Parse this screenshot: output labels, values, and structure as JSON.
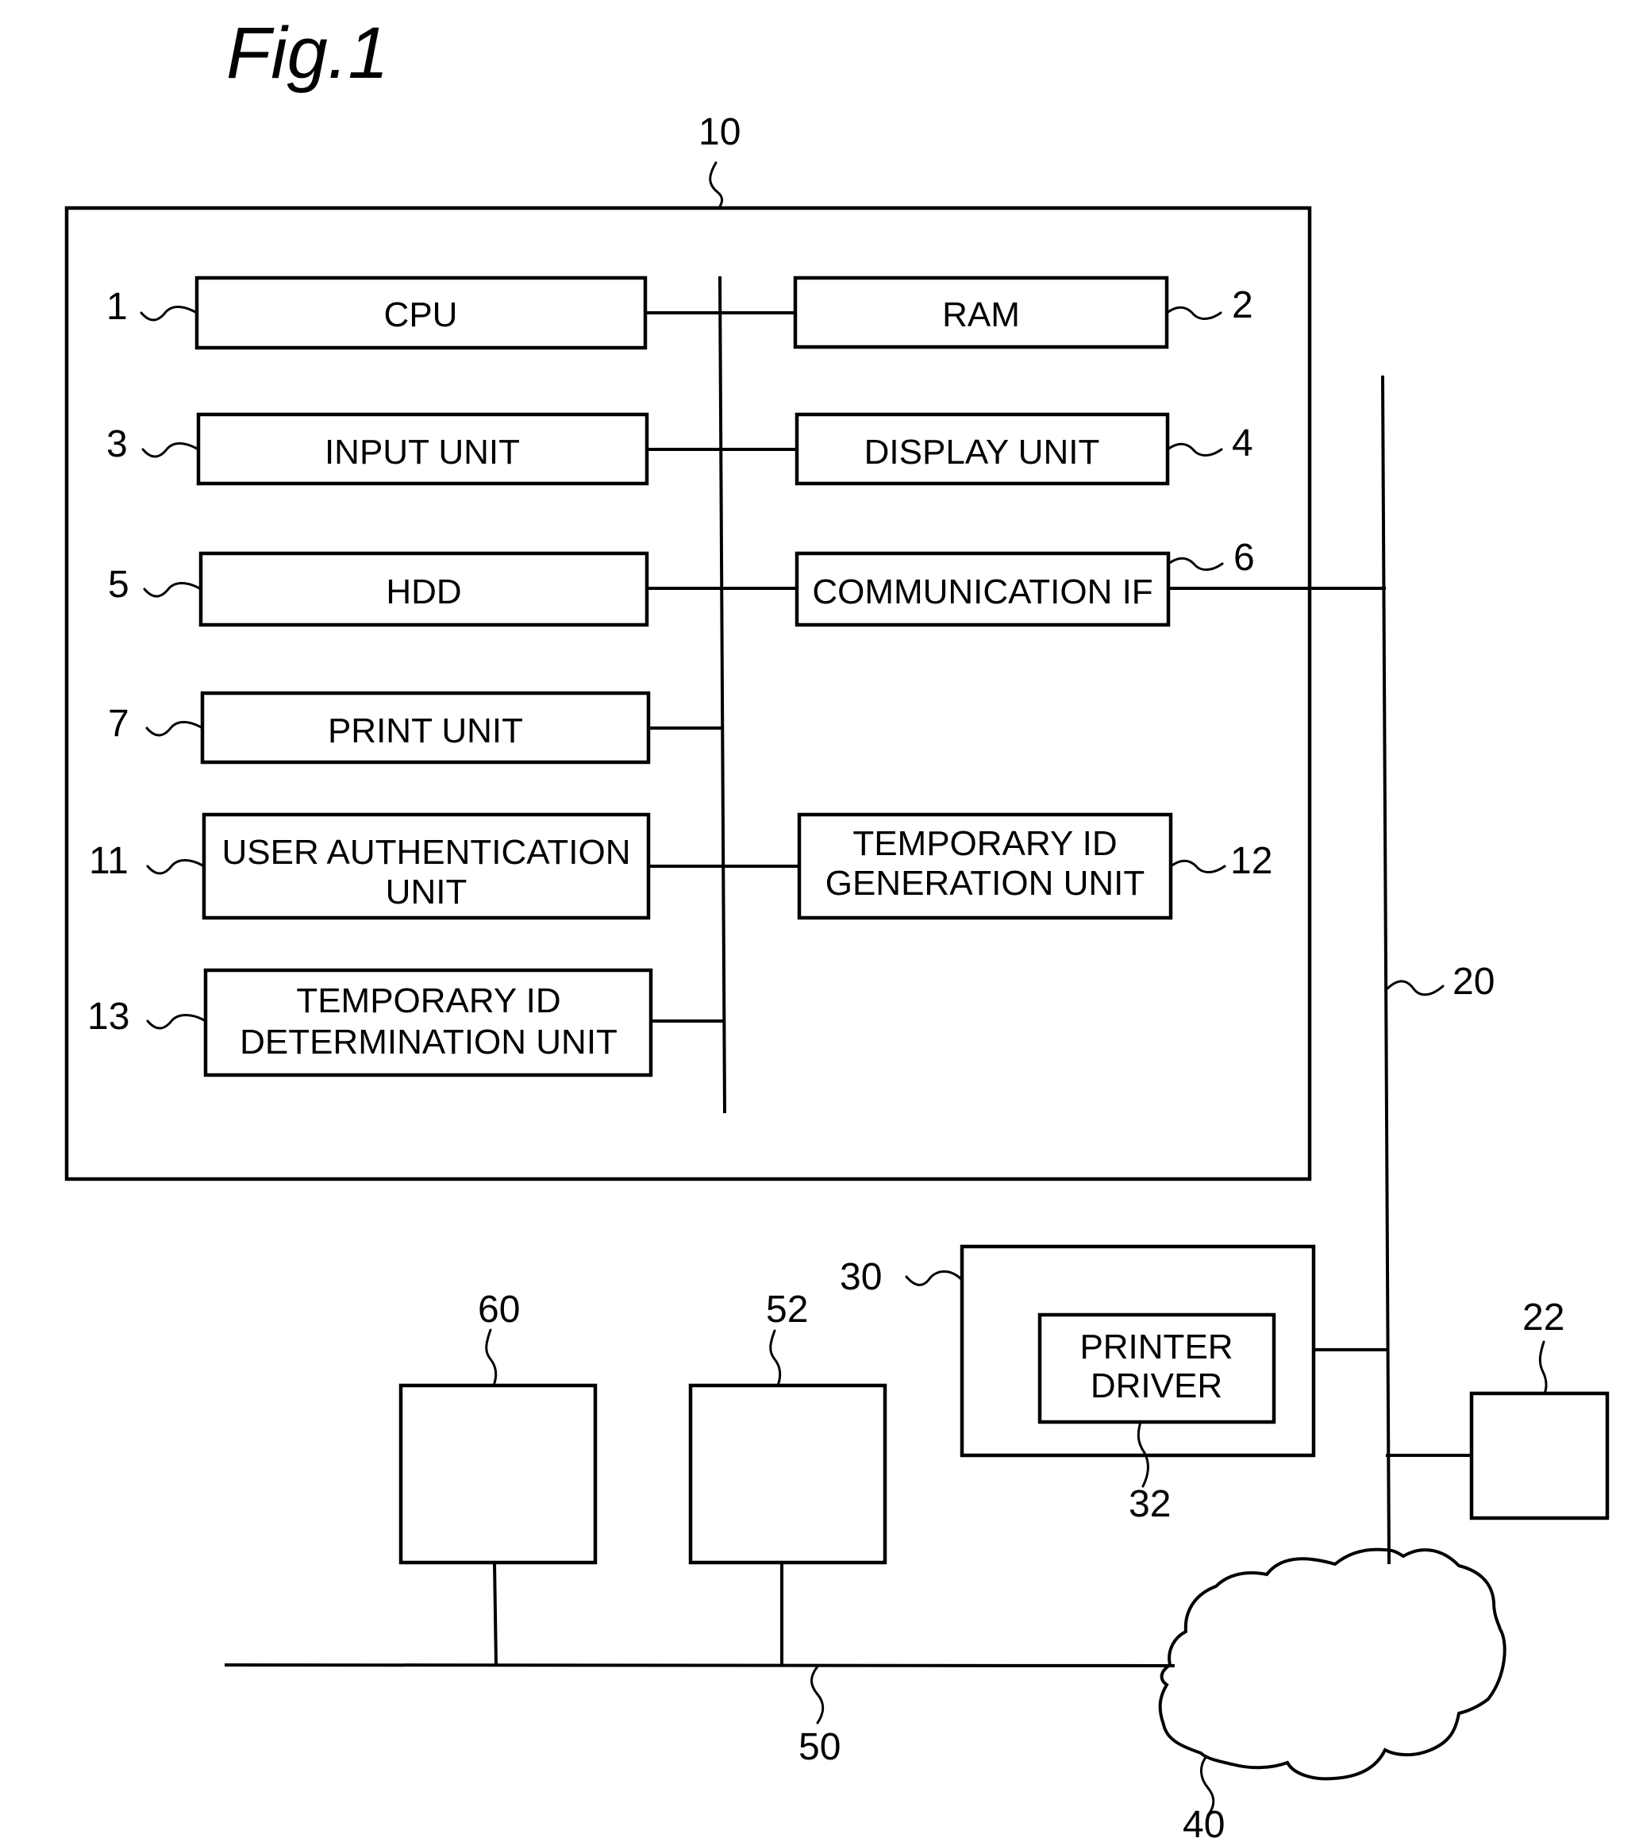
{
  "figure": {
    "title": "Fig.1"
  },
  "apparatus": {
    "ref": "10",
    "units": [
      {
        "ref": "1",
        "lines": [
          "CPU"
        ]
      },
      {
        "ref": "2",
        "lines": [
          "RAM"
        ]
      },
      {
        "ref": "3",
        "lines": [
          "INPUT  UNIT"
        ]
      },
      {
        "ref": "4",
        "lines": [
          "DISPLAY  UNIT"
        ]
      },
      {
        "ref": "5",
        "lines": [
          "HDD"
        ]
      },
      {
        "ref": "6",
        "lines": [
          "COMMUNICATION  IF"
        ]
      },
      {
        "ref": "7",
        "lines": [
          "PRINT  UNIT"
        ]
      },
      {
        "ref": "11",
        "lines": [
          "USER  AUTHENTICATION",
          "UNIT"
        ]
      },
      {
        "ref": "12",
        "lines": [
          "TEMPORARY  ID",
          "GENERATION  UNIT"
        ]
      },
      {
        "ref": "13",
        "lines": [
          "TEMPORARY  ID",
          "DETERMINATION  UNIT"
        ]
      }
    ]
  },
  "network": {
    "ref": "20"
  },
  "terminal": {
    "ref": "30",
    "driver": {
      "ref": "32",
      "lines": [
        "PRINTER",
        "DRIVER"
      ]
    }
  },
  "device_22": {
    "ref": "22"
  },
  "cloud": {
    "ref": "40"
  },
  "lan": {
    "ref": "50"
  },
  "device_52": {
    "ref": "52"
  },
  "device_60": {
    "ref": "60"
  }
}
